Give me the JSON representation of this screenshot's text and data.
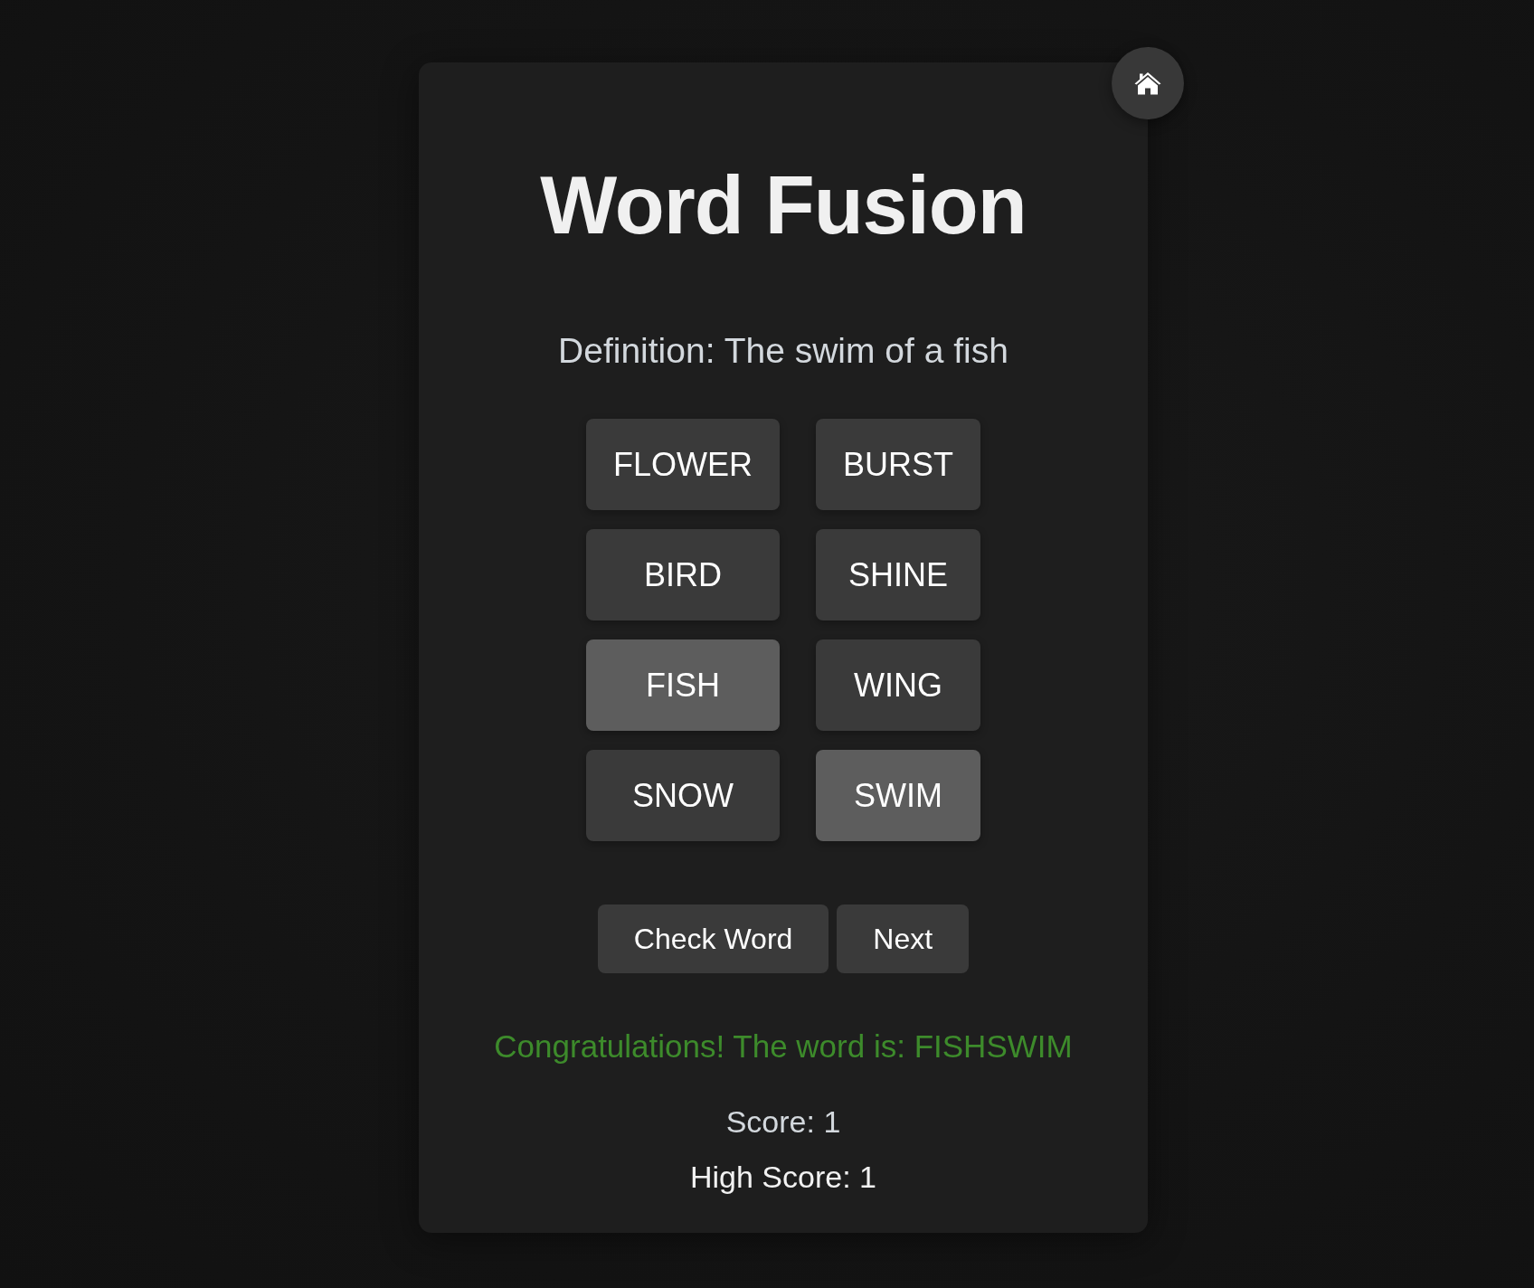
{
  "title": "Word Fusion",
  "definition": "Definition: The swim of a fish",
  "tiles": [
    {
      "label": "FLOWER",
      "selected": false
    },
    {
      "label": "BURST",
      "selected": false
    },
    {
      "label": "BIRD",
      "selected": false
    },
    {
      "label": "SHINE",
      "selected": false
    },
    {
      "label": "FISH",
      "selected": true
    },
    {
      "label": "WING",
      "selected": false
    },
    {
      "label": "SNOW",
      "selected": false
    },
    {
      "label": "SWIM",
      "selected": true
    }
  ],
  "buttons": [
    "Check Word",
    "Next"
  ],
  "message": {
    "text": "Congratulations! The word is: FISHSWIM",
    "kind": "success"
  },
  "score": "Score: 1",
  "high_score": "High Score: 1"
}
